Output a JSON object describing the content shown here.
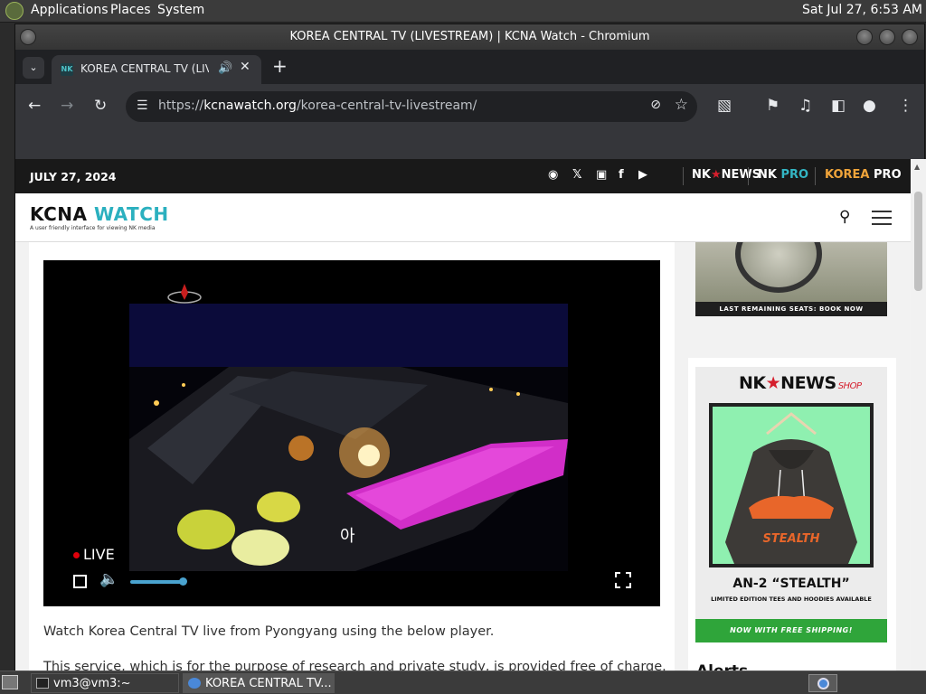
{
  "desktop": {
    "menu": [
      "Applications",
      "Places",
      "System"
    ],
    "clock": "Sat Jul 27,  6:53 AM"
  },
  "window": {
    "title": "KOREA CENTRAL TV (LIVESTREAM) | KCNA Watch - Chromium"
  },
  "tab": {
    "title": "KOREA CENTRAL TV (LIVESTREAM) | KCNA Watch",
    "favicon_text": "NK"
  },
  "omnibox": {
    "scheme": "https://",
    "host": "kcnawatch.org",
    "path": "/korea-central-tv-livestream/"
  },
  "site": {
    "date": "JULY 27, 2024",
    "brands": [
      {
        "a": "NK",
        "b": "NEWS",
        "color_a": "#ffffff",
        "color_b": "#ffffff"
      },
      {
        "a": "NK ",
        "b": "PRO",
        "color_a": "#ffffff",
        "color_b": "#33b6c4"
      },
      {
        "a": "KOREA ",
        "b": "PRO",
        "color_a": "#f0a43a",
        "color_b": "#ffffff"
      }
    ],
    "logo_main": "KCNA",
    "logo_accent": "WATCH",
    "tagline": "A user friendly interface for viewing NK media",
    "accent_color": "#2bb0bf"
  },
  "player": {
    "live_label": "LIVE",
    "volume_level": 0.45,
    "overlay_glyph": "아"
  },
  "content": {
    "intro": "Watch Korea Central TV live from Pyongyang using the below player.",
    "intro2": "This service, which is for the purpose of research and private study, is provided free of charge."
  },
  "sidebar": {
    "ad1_caption": "LAST REMAINING SEATS: BOOK NOW",
    "shop_brand_a": "NK",
    "shop_brand_b": "NEWS",
    "shop_label": "SHOP",
    "product_name": "AN-2 “STEALTH”",
    "product_sub": "LIMITED EDITION TEES AND HOODIES AVAILABLE",
    "shipping": "NOW WITH FREE SHIPPING!",
    "hoodie_print": "STEALTH",
    "alerts_title": "Alerts"
  },
  "taskbar": {
    "terminal": "vm3@vm3:~",
    "browser": "KOREA CENTRAL TV..."
  }
}
